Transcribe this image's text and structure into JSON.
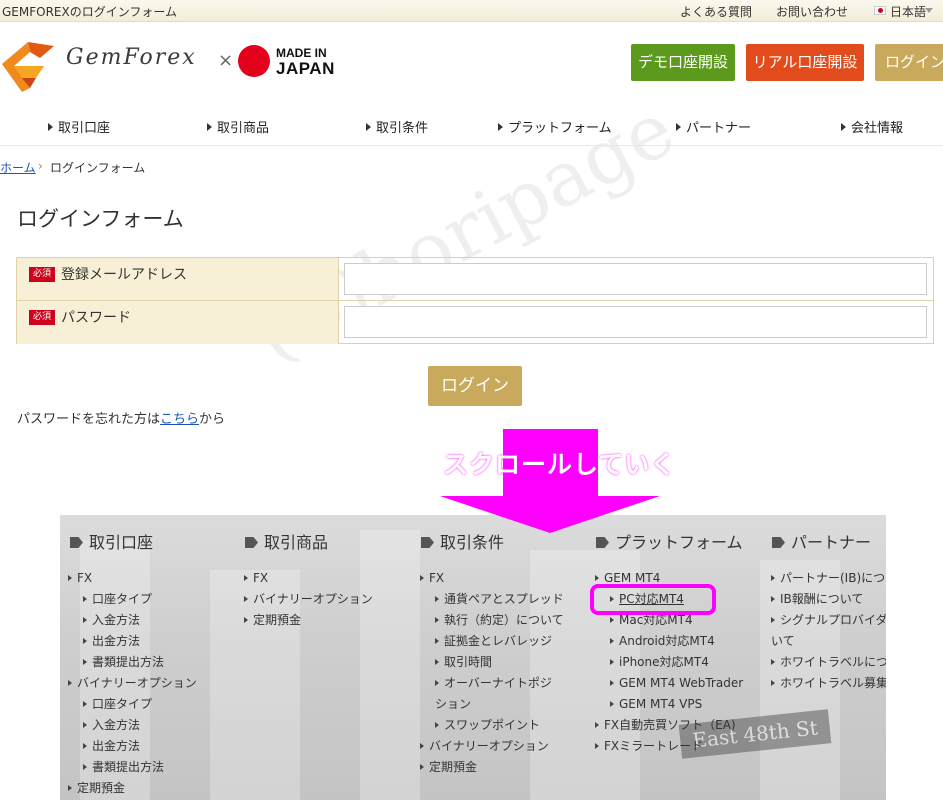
{
  "topbar": {
    "title": "GEMFOREXのログインフォーム",
    "faq": "よくある質問",
    "contact": "お問い合わせ",
    "language": "日本語"
  },
  "header": {
    "logo_text": "GemForex",
    "times": "×",
    "made_line1": "MADE IN",
    "made_line2": "JAPAN",
    "demo_button": "デモ口座開設",
    "real_button": "リアル口座開設",
    "login_button": "ログイン"
  },
  "nav": [
    "取引口座",
    "取引商品",
    "取引条件",
    "プラットフォーム",
    "パートナー",
    "会社情報"
  ],
  "breadcrumb": {
    "home": "ホーム",
    "sep": "›",
    "current": "ログインフォーム"
  },
  "page_title": "ログインフォーム",
  "form": {
    "required_badge": "必須",
    "email_label": "登録メールアドレス",
    "email_value": "",
    "password_label": "パスワード",
    "password_value": "",
    "submit": "ログイン",
    "forgot_prefix": "パスワードを忘れた方は",
    "forgot_link": "こちら",
    "forgot_suffix": "から"
  },
  "watermark": "(C)horipage",
  "annotation": {
    "scroll_text": "スクロールしていく",
    "arrow_color": "#ff00ff"
  },
  "sitemap": {
    "col1": {
      "head": "取引口座",
      "items": [
        "FX",
        "口座タイプ",
        "入金方法",
        "出金方法",
        "書類提出方法",
        "バイナリーオプション",
        "口座タイプ",
        "入金方法",
        "出金方法",
        "書類提出方法",
        "定期預金"
      ]
    },
    "col2": {
      "head": "取引商品",
      "items": [
        "FX",
        "バイナリーオプション",
        "定期預金"
      ]
    },
    "col3": {
      "head": "取引条件",
      "items": [
        "FX",
        "通貨ペアとスプレッド",
        "執行（約定）について",
        "証拠金とレバレッジ",
        "取引時間",
        "オーバーナイトポジ",
        "ション",
        "スワップポイント",
        "バイナリーオプション",
        "定期預金"
      ]
    },
    "col4": {
      "head": "プラットフォーム",
      "items": [
        "GEM MT4",
        "PC対応MT4",
        "Mac対応MT4",
        "Android対応MT4",
        "iPhone対応MT4",
        "GEM MT4 WebTrader",
        "GEM MT4 VPS",
        "FX自動売買ソフト（EA)",
        "FXミラートレード"
      ]
    },
    "col5": {
      "head": "パートナー",
      "items": [
        "パートナー(IB)につ",
        "IB報酬について",
        "シグナルプロバイダ",
        "いて",
        "ホワイトラベルにつ",
        "ホワイトラベル募集"
      ]
    },
    "sign": "East 48th St"
  },
  "colors": {
    "gold": "#c9a95b",
    "demo_green": "#5b9a1c",
    "real_red": "#e24b1c",
    "required_red": "#d0021b",
    "highlight": "#ff00ff"
  }
}
